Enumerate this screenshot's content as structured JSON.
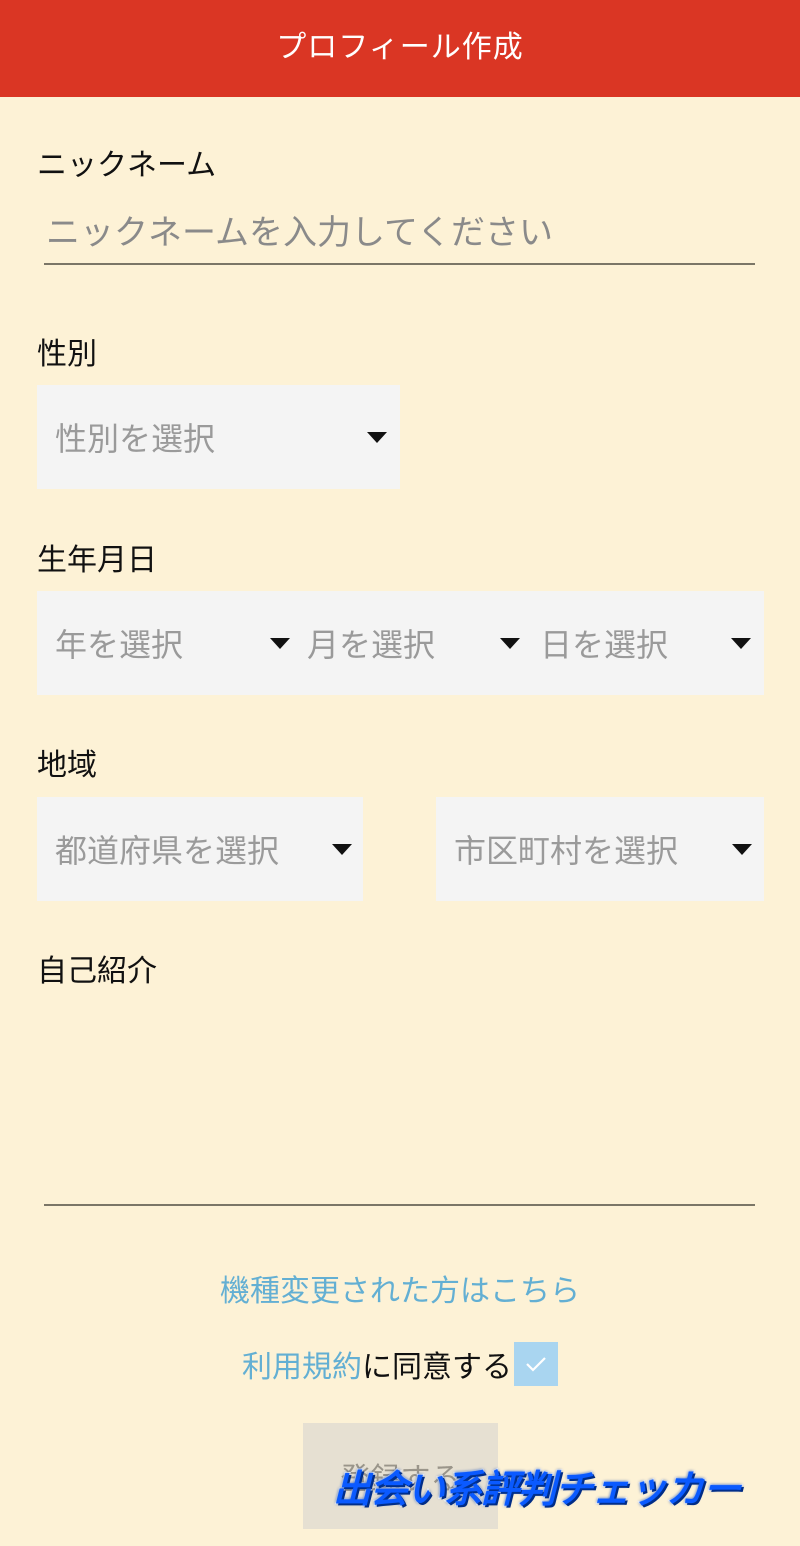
{
  "header": {
    "title": "プロフィール作成"
  },
  "nickname": {
    "label": "ニックネーム",
    "placeholder": "ニックネームを入力してください"
  },
  "gender": {
    "label": "性別",
    "placeholder": "性別を選択"
  },
  "birthday": {
    "label": "生年月日",
    "year_placeholder": "年を選択",
    "month_placeholder": "月を選択",
    "day_placeholder": "日を選択"
  },
  "region": {
    "label": "地域",
    "prefecture_placeholder": "都道府県を選択",
    "city_placeholder": "市区町村を選択"
  },
  "bio": {
    "label": "自己紹介"
  },
  "device_change_link": "機種変更された方はこちら",
  "agree": {
    "terms_link": "利用規約",
    "text": "に同意する",
    "checked": true
  },
  "submit": {
    "label": "登録する"
  },
  "watermark": "出会い系評判チェッカー",
  "colors": {
    "header": "#da3624",
    "background": "#fdf2d6",
    "link": "#63afd3",
    "checkbox": "#a9d5f0"
  }
}
